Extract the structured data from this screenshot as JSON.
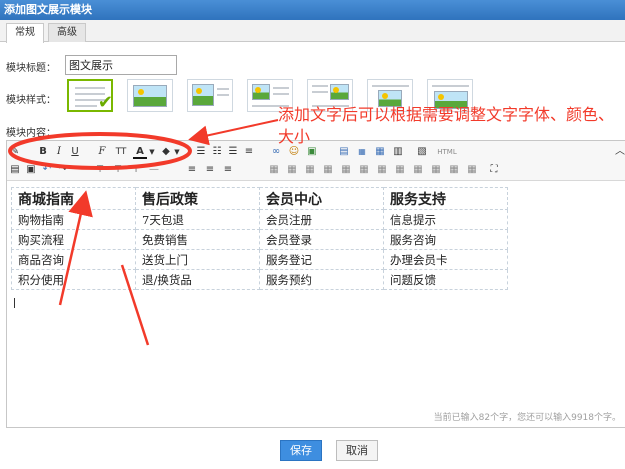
{
  "window": {
    "title": "添加图文展示模块"
  },
  "tabs": [
    {
      "label": "常规"
    },
    {
      "label": "高级"
    }
  ],
  "form": {
    "title_label": "模块标题：",
    "title_value": "图文展示",
    "style_label": "模块样式：",
    "content_label": "模块内容："
  },
  "toolbar": {
    "bold": "B",
    "italic": "I",
    "underline": "U",
    "fontfamily": "F",
    "fontsize": "TT",
    "forecolor": "A",
    "html": "HTML"
  },
  "table": {
    "headers": [
      "商城指南",
      "售后政策",
      "会员中心",
      "服务支持"
    ],
    "rows": [
      [
        "购物指南",
        "7天包退",
        "会员注册",
        "信息提示"
      ],
      [
        "购买流程",
        "免费销售",
        "会员登录",
        "服务咨询"
      ],
      [
        "商品咨询",
        "送货上门",
        "服务登记",
        "办理会员卡"
      ],
      [
        "积分使用",
        "退/换货品",
        "服务预约",
        "问题反馈"
      ]
    ]
  },
  "counter_text": "当前已输入82个字，您还可以输入9918个字。",
  "buttons": {
    "save": "保存",
    "cancel": "取消"
  },
  "annotation": "添加文字后可以根据需要调整文字字体、颜色、大小",
  "colors": {
    "accent": "#3e8ee0",
    "annotation": "#f23a2a",
    "selected_style": "#7ab800"
  }
}
